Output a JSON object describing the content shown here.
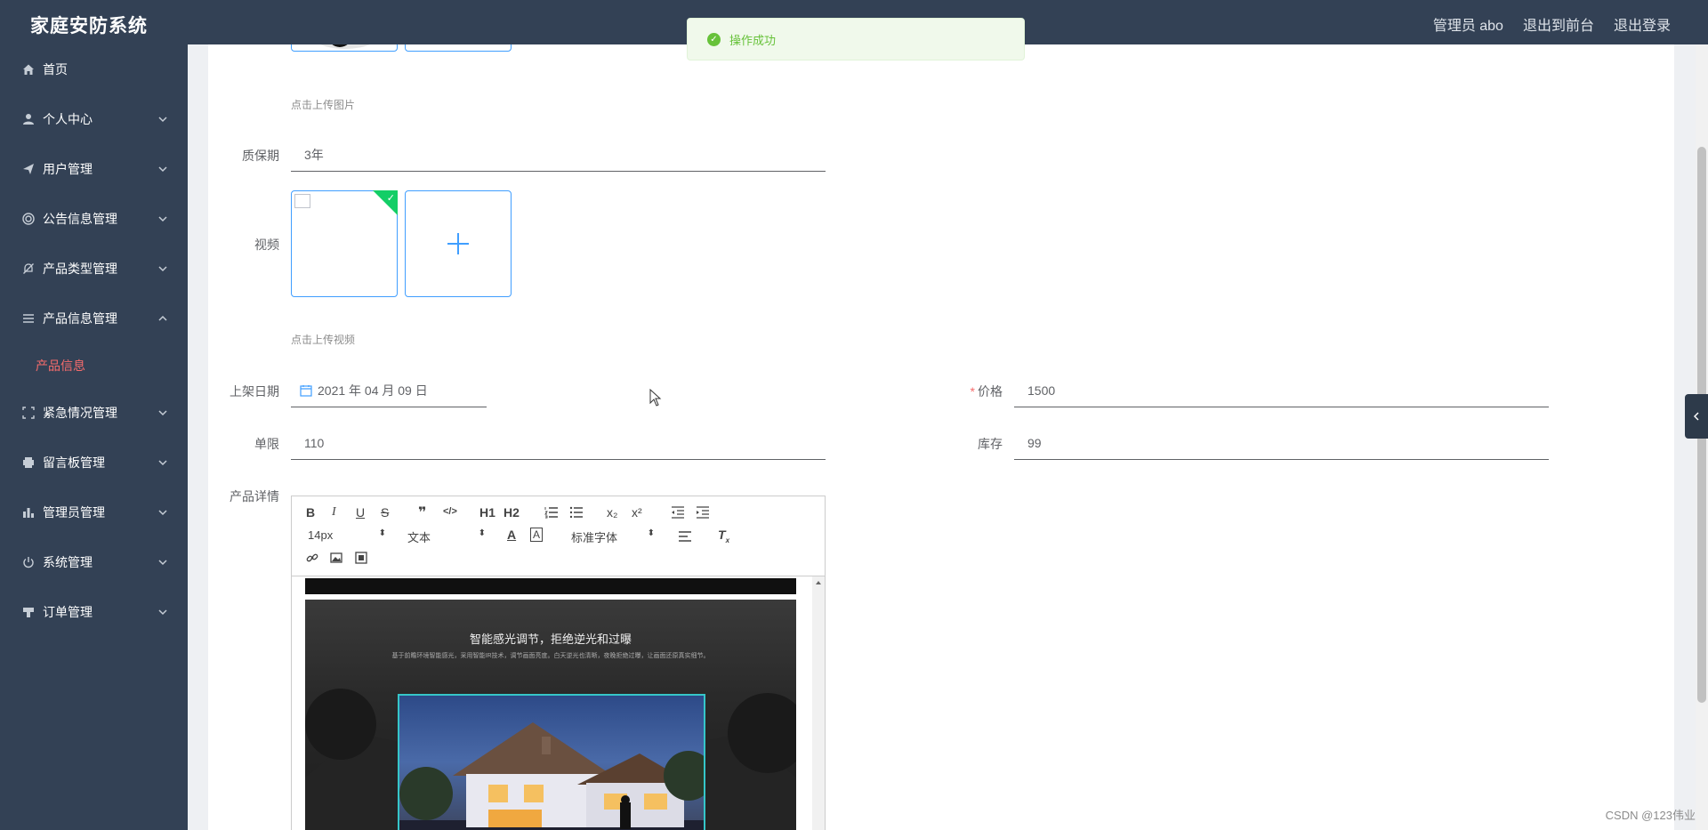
{
  "app": {
    "title": "家庭安防系统"
  },
  "header": {
    "user": "管理员 abo",
    "to_front": "退出到前台",
    "logout": "退出登录"
  },
  "toast": {
    "text": "操作成功",
    "color": "#67c23a"
  },
  "sidebar": {
    "items": [
      {
        "label": "首页",
        "icon": "home-icon",
        "expandable": false
      },
      {
        "label": "个人中心",
        "icon": "user-icon",
        "expandable": true
      },
      {
        "label": "用户管理",
        "icon": "send-icon",
        "expandable": true
      },
      {
        "label": "公告信息管理",
        "icon": "target-icon",
        "expandable": true
      },
      {
        "label": "产品类型管理",
        "icon": "bell-off-icon",
        "expandable": true
      },
      {
        "label": "产品信息管理",
        "icon": "list-icon",
        "expandable": true,
        "expanded": true
      },
      {
        "label": "紧急情况管理",
        "icon": "fullscreen-icon",
        "expandable": true
      },
      {
        "label": "留言板管理",
        "icon": "printer-icon",
        "expandable": true
      },
      {
        "label": "管理员管理",
        "icon": "bar-chart-icon",
        "expandable": true
      },
      {
        "label": "系统管理",
        "icon": "power-icon",
        "expandable": true
      },
      {
        "label": "订单管理",
        "icon": "stamp-icon",
        "expandable": true
      }
    ],
    "submenu": {
      "active": "产品信息",
      "active_color": "#f56c6c"
    }
  },
  "form": {
    "image_hint": "点击上传图片",
    "warranty": {
      "label": "质保期",
      "value": "3年"
    },
    "video": {
      "label": "视频",
      "hint": "点击上传视频"
    },
    "listing_date": {
      "label": "上架日期",
      "value": "2021 年 04 月 09 日"
    },
    "price": {
      "label": "价格",
      "value": "1500",
      "required": "*"
    },
    "limit": {
      "label": "单限",
      "value": "110"
    },
    "stock": {
      "label": "库存",
      "value": "99"
    },
    "details": {
      "label": "产品详情"
    }
  },
  "editor": {
    "toolbar": {
      "bold": "B",
      "italic": "I",
      "underline": "U",
      "strike": "S",
      "quote": "❞",
      "code": "</>",
      "h1": "H1",
      "h2": "H2",
      "sub": "x₂",
      "sup": "x²",
      "size": "14px",
      "header": "文本",
      "font": "标准字体"
    },
    "content": {
      "title": "智能感光调节，拒绝逆光和过曝",
      "subtitle": "基于前瞻环境智能感光，采用智能IR技术，调节画面亮度。白天逆光也清晰，夜晚拒绝过曝，让画面还原真实细节。"
    }
  },
  "watermark": "CSDN @123伟业"
}
